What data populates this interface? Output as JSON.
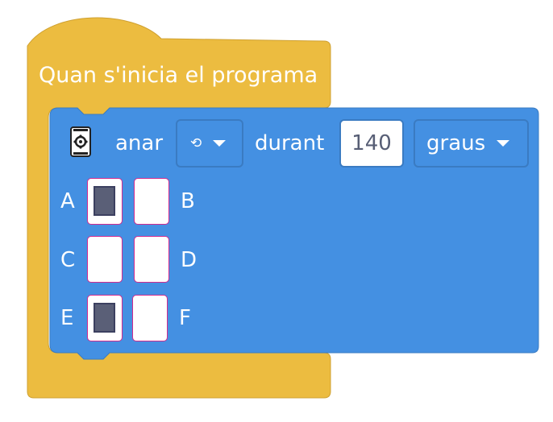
{
  "hat_block": {
    "label": "Quan s'inicia el programa",
    "color": "#ecbc40",
    "border_color": "#cfa030"
  },
  "motor_block": {
    "color": "#4490e2",
    "border_color": "#3a7bc2",
    "icon": "robot-motor-icon",
    "go_label": "anar",
    "direction_dropdown": {
      "icon": "rotate-ccw-icon",
      "glyph": "⟲"
    },
    "during_label": "durant",
    "amount_value": "140",
    "unit_dropdown": {
      "selected": "graus"
    },
    "ports": [
      {
        "label": "A",
        "active": true
      },
      {
        "label": "B",
        "active": false
      },
      {
        "label": "C",
        "active": false
      },
      {
        "label": "D",
        "active": false
      },
      {
        "label": "E",
        "active": true
      },
      {
        "label": "F",
        "active": false
      }
    ]
  }
}
